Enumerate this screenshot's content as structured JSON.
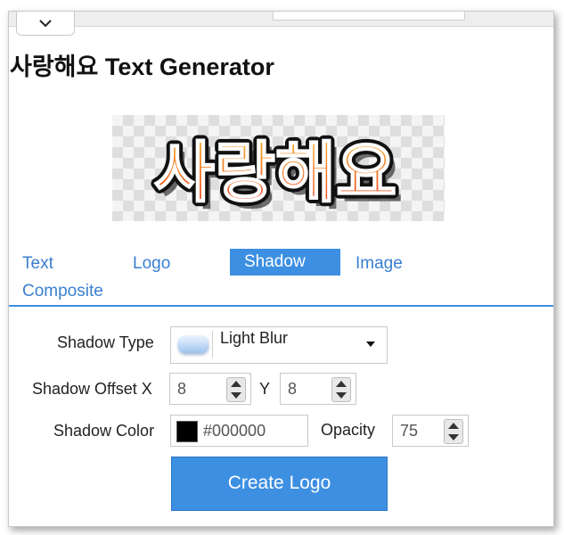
{
  "window": {
    "collapse_icon": "chevron-down-icon"
  },
  "page": {
    "title": "사랑해요 Text Generator"
  },
  "preview": {
    "logo_text": "사랑해요"
  },
  "tabs": [
    {
      "label": "Text",
      "active": false
    },
    {
      "label": "Logo",
      "active": false
    },
    {
      "label": "Shadow",
      "active": true
    },
    {
      "label": "Image",
      "active": false
    },
    {
      "label": "Composite",
      "active": false
    }
  ],
  "shadow_form": {
    "type_label": "Shadow Type",
    "type_value": "Light Blur",
    "offset_x_label": "Shadow Offset X",
    "offset_x_value": "8",
    "offset_y_label": "Y",
    "offset_y_value": "8",
    "color_label": "Shadow Color",
    "color_value": "#000000",
    "opacity_label": "Opacity",
    "opacity_value": "75"
  },
  "actions": {
    "create_label": "Create Logo"
  },
  "colors": {
    "accent": "#3d8fe2",
    "tab_text": "#3a7fd0",
    "logo_gradient_top": "#f7b52a",
    "logo_gradient_bottom": "#ef3a24"
  }
}
